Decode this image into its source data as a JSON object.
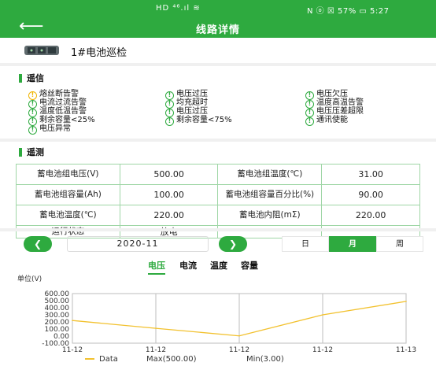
{
  "status_bar": {
    "left": "HD ⁴⁶.ıl ≋",
    "right": "N ⓞ ☒ 57% ▭ 5:27"
  },
  "header": {
    "back_glyph": "⟵",
    "title": "线路详情"
  },
  "device": {
    "name": "1#电池巡检"
  },
  "telesignal": {
    "title": "遥信",
    "alarms": [
      {
        "label": "熔丝断告警",
        "level": "warn"
      },
      {
        "label": "电压过压",
        "level": "normal"
      },
      {
        "label": "电压欠压",
        "level": "normal"
      },
      {
        "label": "电流过流告警",
        "level": "normal"
      },
      {
        "label": "均充超时",
        "level": "normal"
      },
      {
        "label": "温度高温告警",
        "level": "normal"
      },
      {
        "label": "温度低温告警",
        "level": "normal"
      },
      {
        "label": "电压过压",
        "level": "normal"
      },
      {
        "label": "电压压差超限",
        "level": "normal"
      },
      {
        "label": "剩余容量<25%",
        "level": "normal"
      },
      {
        "label": "剩余容量<75%",
        "level": "normal"
      },
      {
        "label": "通讯使能",
        "level": "normal"
      },
      {
        "label": "电压异常",
        "level": "normal"
      }
    ]
  },
  "telemetry": {
    "title": "遥测",
    "rows": [
      [
        {
          "label": "蓄电池组电压(V)",
          "value": "500.00"
        },
        {
          "label": "蓄电池组温度(℃)",
          "value": "31.00"
        }
      ],
      [
        {
          "label": "蓄电池组容量(Ah)",
          "value": "100.00"
        },
        {
          "label": "蓄电池组容量百分比(%)",
          "value": "90.00"
        }
      ],
      [
        {
          "label": "蓄电池温度(℃)",
          "value": "220.00"
        },
        {
          "label": "蓄电池内阻(mΣ)",
          "value": "220.00"
        }
      ],
      [
        {
          "label": "运行状态",
          "value": "放电"
        },
        {
          "label": "",
          "value": ""
        }
      ]
    ]
  },
  "period": {
    "month": "2020-11",
    "prev_glyph": "❮",
    "next_glyph": "❯",
    "segments": [
      {
        "label": "日",
        "active": false
      },
      {
        "label": "月",
        "active": true
      },
      {
        "label": "周",
        "active": false
      }
    ]
  },
  "metric_tabs": [
    {
      "label": "电压",
      "active": true
    },
    {
      "label": "电流",
      "active": false
    },
    {
      "label": "温度",
      "active": false
    },
    {
      "label": "容量",
      "active": false
    }
  ],
  "chart_data": {
    "type": "line",
    "unit_label": "单位(V)",
    "x": [
      "11-12",
      "11-12",
      "11-12",
      "11-12",
      "11-13"
    ],
    "series": [
      {
        "name": "Data",
        "values": [
          220,
          110,
          3,
          300,
          490
        ],
        "color": "#f2c12e"
      }
    ],
    "yticks": [
      "600.00",
      "500.00",
      "400.00",
      "300.00",
      "200.00",
      "100.00",
      "0.00",
      "-100.00"
    ],
    "ylim": [
      -100,
      600
    ],
    "legend": [
      "Data",
      "Max(500.00)",
      "Min(3.00)"
    ],
    "legend_position": "bottom",
    "grid": true
  },
  "colors": {
    "brand": "#2eaa3f",
    "warn": "#f0b400",
    "line": "#f2c12e"
  }
}
